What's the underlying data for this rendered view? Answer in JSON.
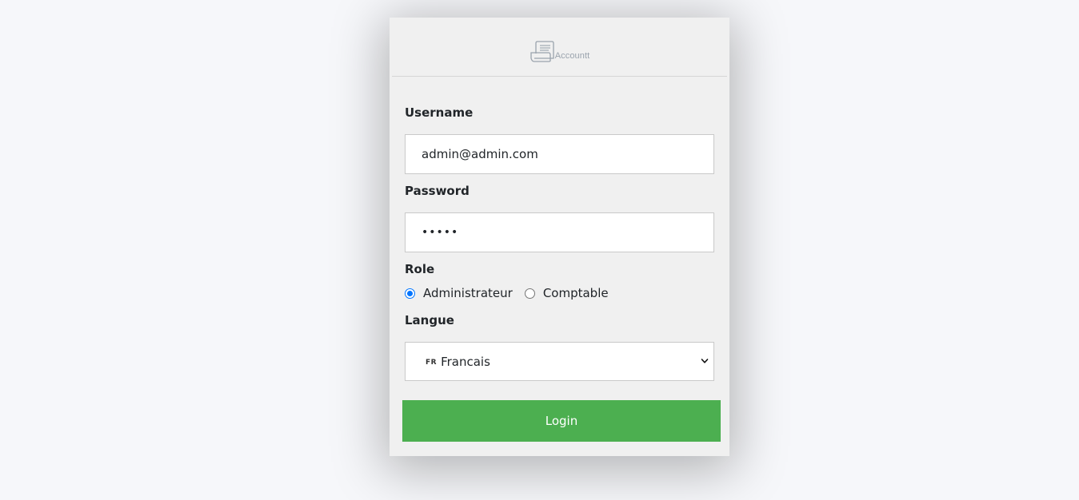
{
  "brand": {
    "logo_text": "Accountt",
    "logo_icon": "document-scroll-icon"
  },
  "form": {
    "username_label": "Username",
    "username_value": "admin@admin.com",
    "password_label": "Password",
    "password_value": "•••••",
    "role_label": "Role",
    "role_options": [
      {
        "label": "Administrateur",
        "selected": true
      },
      {
        "label": "Comptable",
        "selected": false
      }
    ],
    "language_label": "Langue",
    "language_flag": "FR",
    "language_selected": "Francais",
    "login_label": "Login"
  },
  "colors": {
    "background": "#f6f7fa",
    "card": "#f0f0f0",
    "login_button": "#4caf50",
    "radio_accent": "#0075ff"
  }
}
